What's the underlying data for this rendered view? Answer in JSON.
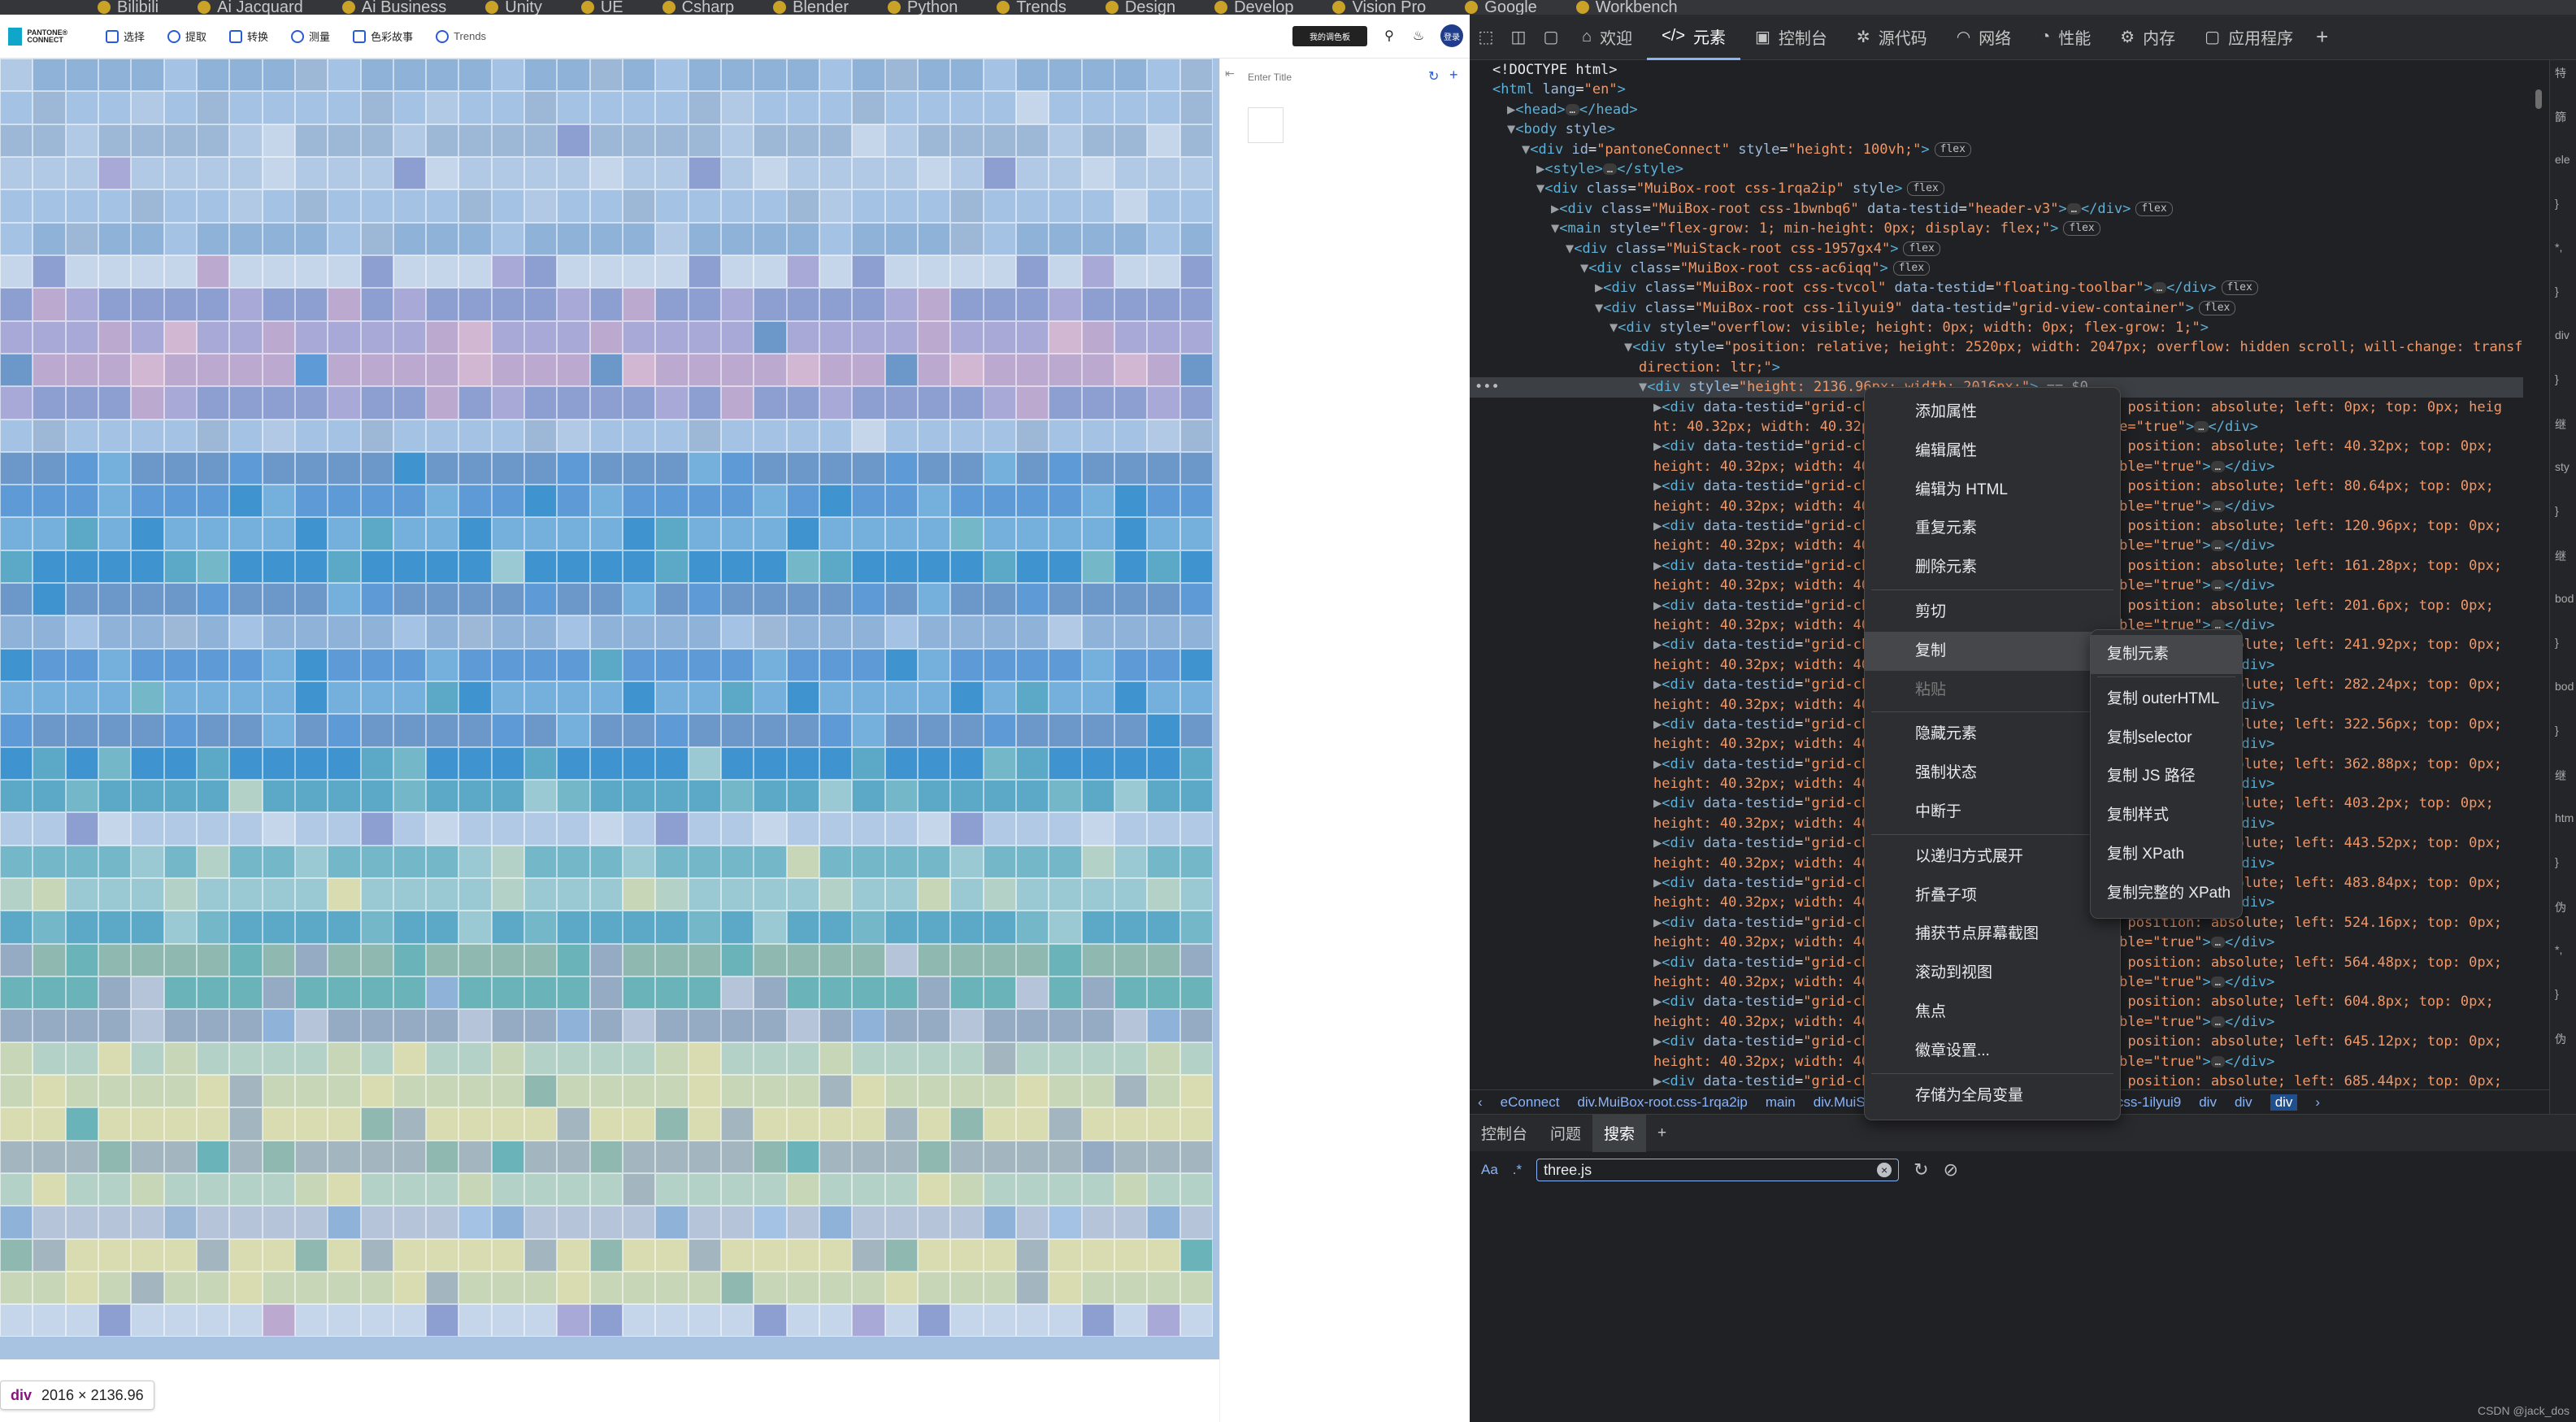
{
  "bookmarks": [
    "Bilibili",
    "Ai Jacquard",
    "Ai Business",
    "Unity",
    "UE",
    "Csharp",
    "Blender",
    "Python",
    "Trends",
    "Design",
    "Develop",
    "Vision Pro",
    "Google",
    "Workbench"
  ],
  "app": {
    "logo_text": "PANTONE® CONNECT",
    "nav": [
      {
        "label": "选择",
        "icon": "select-icon"
      },
      {
        "label": "提取",
        "icon": "extract-icon"
      },
      {
        "label": "转换",
        "icon": "convert-icon"
      },
      {
        "label": "测量",
        "icon": "measure-icon"
      },
      {
        "label": "色彩故事",
        "icon": "color-story-icon"
      },
      {
        "label": "Trends",
        "icon": "trends-icon"
      }
    ],
    "workspace_button": "我的调色板",
    "avatar": "登录",
    "side_title_placeholder": "Enter Title",
    "size_tooltip": {
      "tag": "div",
      "size": "2016 × 2136.96"
    },
    "grid": {
      "chip_size": 40.32,
      "cols": 37,
      "rows": 39,
      "palette": [
        "#8fb2d8",
        "#a3c2e4",
        "#9db7d6",
        "#b2c9e6",
        "#c5d6ea",
        "#8c9fd0",
        "#a8a9d6",
        "#bca9cf",
        "#d2b7d3",
        "#6b98c9",
        "#5e9bd6",
        "#75b0dd",
        "#3f94cf",
        "#5ca8c7",
        "#73b7c9",
        "#9ac9d3",
        "#b4d1c7",
        "#c7d6b6",
        "#d8dcb0",
        "#a3b5be",
        "#8eb8b0",
        "#6ab3b9",
        "#95aac3",
        "#b5c4d8"
      ]
    }
  },
  "devtools": {
    "tabs": [
      {
        "label": "欢迎",
        "icon": "home-icon"
      },
      {
        "label": "元素",
        "icon": "code-icon",
        "active": true
      },
      {
        "label": "控制台",
        "icon": "console-icon"
      },
      {
        "label": "源代码",
        "icon": "bug-icon"
      },
      {
        "label": "网络",
        "icon": "wifi-icon"
      },
      {
        "label": "性能",
        "icon": "gauge-icon"
      },
      {
        "label": "内存",
        "icon": "gear-icon"
      },
      {
        "label": "应用程序",
        "icon": "app-icon"
      }
    ],
    "tree_rows": [
      {
        "indent": 0,
        "html": "<span class='p'>&lt;!DOCTYPE html&gt;</span>"
      },
      {
        "indent": 0,
        "html": "<span class='t'>&lt;html</span> <span class='a'>lang</span>=<span class='v'>\"en\"</span><span class='t'>&gt;</span>"
      },
      {
        "indent": 1,
        "html": "<span class='g'>▶</span><span class='t'>&lt;head&gt;</span><span class='ell'>…</span><span class='t'>&lt;/head&gt;</span>"
      },
      {
        "indent": 1,
        "html": "<span class='g'>▼</span><span class='t'>&lt;body</span> <span class='a'>style</span><span class='t'>&gt;</span>"
      },
      {
        "indent": 2,
        "html": "<span class='g'>▼</span><span class='t'>&lt;div</span> <span class='a'>id</span>=<span class='v'>\"pantoneConnect\"</span> <span class='a'>style</span>=<span class='v'>\"height: 100vh;\"</span><span class='t'>&gt;</span><span class='flex-badge'>flex</span>"
      },
      {
        "indent": 3,
        "html": "<span class='g'>▶</span><span class='t'>&lt;style&gt;</span><span class='ell'>…</span><span class='t'>&lt;/style&gt;</span>"
      },
      {
        "indent": 3,
        "html": "<span class='g'>▼</span><span class='t'>&lt;div</span> <span class='a'>class</span>=<span class='v'>\"MuiBox-root css-1rqa2ip\"</span> <span class='a'>style</span><span class='t'>&gt;</span><span class='flex-badge'>flex</span>"
      },
      {
        "indent": 4,
        "html": "<span class='g'>▶</span><span class='t'>&lt;div</span> <span class='a'>class</span>=<span class='v'>\"MuiBox-root css-1bwnbq6\"</span> <span class='a'>data-testid</span>=<span class='v'>\"header-v3\"</span><span class='t'>&gt;</span><span class='ell'>…</span><span class='t'>&lt;/div&gt;</span><span class='flex-badge'>flex</span>"
      },
      {
        "indent": 4,
        "html": "<span class='g'>▼</span><span class='t'>&lt;main</span> <span class='a'>style</span>=<span class='v'>\"flex-grow: 1; min-height: 0px; display: flex;\"</span><span class='t'>&gt;</span><span class='flex-badge'>flex</span>"
      },
      {
        "indent": 5,
        "html": "<span class='g'>▼</span><span class='t'>&lt;div</span> <span class='a'>class</span>=<span class='v'>\"MuiStack-root css-1957gx4\"</span><span class='t'>&gt;</span><span class='flex-badge'>flex</span>"
      },
      {
        "indent": 6,
        "html": "<span class='g'>▼</span><span class='t'>&lt;div</span> <span class='a'>class</span>=<span class='v'>\"MuiBox-root css-ac6iqq\"</span><span class='t'>&gt;</span><span class='flex-badge'>flex</span>"
      },
      {
        "indent": 7,
        "html": "<span class='g'>▶</span><span class='t'>&lt;div</span> <span class='a'>class</span>=<span class='v'>\"MuiBox-root css-tvcol\"</span> <span class='a'>data-testid</span>=<span class='v'>\"floating-toolbar\"</span><span class='t'>&gt;</span><span class='ell'>…</span><span class='t'>&lt;/div&gt;</span><span class='flex-badge'>flex</span>"
      },
      {
        "indent": 7,
        "html": "<span class='g'>▼</span><span class='t'>&lt;div</span> <span class='a'>class</span>=<span class='v'>\"MuiBox-root css-1ilyui9\"</span> <span class='a'>data-testid</span>=<span class='v'>\"grid-view-container\"</span><span class='t'>&gt;</span><span class='flex-badge'>flex</span>"
      },
      {
        "indent": 8,
        "html": "<span class='g'>▼</span><span class='t'>&lt;div</span> <span class='a'>style</span>=<span class='v'>\"overflow: visible; height: 0px; width: 0px; flex-grow: 1;\"</span><span class='t'>&gt;</span>"
      },
      {
        "indent": 9,
        "html": "<span class='g'>▼</span><span class='t'>&lt;div</span> <span class='a'>style</span>=<span class='v'>\"position: relative; height: 2520px; width: 2047px; overflow: hidden scroll; will-change: transform;</span>"
      },
      {
        "indent": 10,
        "html": "<span class='v'>direction: ltr;\"</span><span class='t'>&gt;</span>"
      },
      {
        "indent": 10,
        "sel": true,
        "html": "<span class='g'>▼</span><span class='t'>&lt;div</span> <span class='a'>style</span>=<span class='v'>\"height: 2136.96px; width: 2016px;\"</span><span class='t'>&gt;</span> <span class='g'>== $0</span>"
      },
      {
        "indent": 11,
        "html": "<span class='g'>▶</span><span class='t'>&lt;div</span> <span class='a'>data-testid</span>=<span class='v'>\"grid-chip-</span>                   <span class='v'>pointer; position: absolute; left: 0px; top: 0px; heig</span>"
      },
      {
        "indent": 11,
        "html": "<span class='v'>ht: 40.32px; width: 40.32px;</span>                       <span class='v'>agable=\"true\"</span><span class='t'>&gt;</span><span class='ell'>…</span><span class='t'>&lt;/div&gt;</span>"
      },
      {
        "indent": 11,
        "html": "<span class='g'>▶</span><span class='t'>&lt;div</span> <span class='a'>data-testid</span>=<span class='v'>\"grid-chip-</span>                   <span class='v'>pointer; position: absolute; left: 40.32px; top: 0px;</span>"
      },
      {
        "indent": 11,
        "html": "<span class='v'>height: 40.32px; width: 40.3</span>                       <span class='v'>raggable=\"true\"</span><span class='t'>&gt;</span><span class='ell'>…</span><span class='t'>&lt;/div&gt;</span>"
      },
      {
        "indent": 11,
        "html": "<span class='g'>▶</span><span class='t'>&lt;div</span> <span class='a'>data-testid</span>=<span class='v'>\"grid-chip-</span>                   <span class='v'>pointer; position: absolute; left: 80.64px; top: 0px;</span>"
      },
      {
        "indent": 11,
        "html": "<span class='v'>height: 40.32px; width: 40.3</span>                       <span class='v'>raggable=\"true\"</span><span class='t'>&gt;</span><span class='ell'>…</span><span class='t'>&lt;/div&gt;</span>"
      },
      {
        "indent": 11,
        "html": "<span class='g'>▶</span><span class='t'>&lt;div</span> <span class='a'>data-testid</span>=<span class='v'>\"grid-chip-</span>                   <span class='v'>pointer; position: absolute; left: 120.96px; top: 0px;</span>"
      },
      {
        "indent": 11,
        "html": "<span class='v'>height: 40.32px; width: 40.3</span>                       <span class='v'>raggable=\"true\"</span><span class='t'>&gt;</span><span class='ell'>…</span><span class='t'>&lt;/div&gt;</span>"
      },
      {
        "indent": 11,
        "html": "<span class='g'>▶</span><span class='t'>&lt;div</span> <span class='a'>data-testid</span>=<span class='v'>\"grid-chip-</span>                   <span class='v'>pointer; position: absolute; left: 161.28px; top: 0px;</span>"
      },
      {
        "indent": 11,
        "html": "<span class='v'>height: 40.32px; width: 40.3</span>                       <span class='v'>raggable=\"true\"</span><span class='t'>&gt;</span><span class='ell'>…</span><span class='t'>&lt;/div&gt;</span>"
      },
      {
        "indent": 11,
        "html": "<span class='g'>▶</span><span class='t'>&lt;div</span> <span class='a'>data-testid</span>=<span class='v'>\"grid-chip-</span>                   <span class='v'>pointer; position: absolute; left: 201.6px; top: 0px;</span>"
      },
      {
        "indent": 11,
        "html": "<span class='v'>height: 40.32px; width: 40.3</span>                       <span class='v'>raggable=\"true\"</span><span class='t'>&gt;</span><span class='ell'>…</span><span class='t'>&lt;/div&gt;</span>"
      },
      {
        "indent": 11,
        "html": "<span class='g'>▶</span><span class='t'>&lt;div</span> <span class='a'>data-testid</span>=<span class='v'>\"grid-chip-</span>                   <span class='v'>pointer; position: absolute; left: 241.92px; top: 0px;</span>"
      },
      {
        "indent": 11,
        "html": "<span class='v'>height: 40.32px; width: 40.3</span>                       <span class='v'>raggable=\"true\"</span><span class='t'>&gt;</span><span class='ell'>…</span><span class='t'>&lt;/div&gt;</span>"
      },
      {
        "indent": 11,
        "html": "<span class='g'>▶</span><span class='t'>&lt;div</span> <span class='a'>data-testid</span>=<span class='v'>\"grid-chip-</span>                   <span class='v'>pointer; position: absolute; left: 282.24px; top: 0px;</span>"
      },
      {
        "indent": 11,
        "html": "<span class='v'>height: 40.32px; width: 40.3</span>                       <span class='v'>raggable=\"true\"</span><span class='t'>&gt;</span><span class='ell'>…</span><span class='t'>&lt;/div&gt;</span>"
      },
      {
        "indent": 11,
        "html": "<span class='g'>▶</span><span class='t'>&lt;div</span> <span class='a'>data-testid</span>=<span class='v'>\"grid-chip-</span>                   <span class='v'>pointer; position: absolute; left: 322.56px; top: 0px;</span>"
      },
      {
        "indent": 11,
        "html": "<span class='v'>height: 40.32px; width: 40.3</span>                       <span class='v'>raggable=\"true\"</span><span class='t'>&gt;</span><span class='ell'>…</span><span class='t'>&lt;/div&gt;</span>"
      },
      {
        "indent": 11,
        "html": "<span class='g'>▶</span><span class='t'>&lt;div</span> <span class='a'>data-testid</span>=<span class='v'>\"grid-chip-</span>                   <span class='v'>pointer; position: absolute; left: 362.88px; top: 0px;</span>"
      },
      {
        "indent": 11,
        "html": "<span class='v'>height: 40.32px; width: 40.3</span>                       <span class='v'>raggable=\"true\"</span><span class='t'>&gt;</span><span class='ell'>…</span><span class='t'>&lt;/div&gt;</span>"
      },
      {
        "indent": 11,
        "html": "<span class='g'>▶</span><span class='t'>&lt;div</span> <span class='a'>data-testid</span>=<span class='v'>\"grid-chip-</span>                   <span class='v'>pointer; position: absolute; left: 403.2px; top: 0px;</span>"
      },
      {
        "indent": 11,
        "html": "<span class='v'>height: 40.32px; width: 40.3</span>                       <span class='v'>raggable=\"true\"</span><span class='t'>&gt;</span><span class='ell'>…</span><span class='t'>&lt;/div&gt;</span>"
      },
      {
        "indent": 11,
        "html": "<span class='g'>▶</span><span class='t'>&lt;div</span> <span class='a'>data-testid</span>=<span class='v'>\"grid-chip-</span>                   <span class='v'>pointer; position: absolute; left: 443.52px; top: 0px;</span>"
      },
      {
        "indent": 11,
        "html": "<span class='v'>height: 40.32px; width: 40.3</span>                       <span class='v'>raggable=\"true\"</span><span class='t'>&gt;</span><span class='ell'>…</span><span class='t'>&lt;/div&gt;</span>"
      },
      {
        "indent": 11,
        "html": "<span class='g'>▶</span><span class='t'>&lt;div</span> <span class='a'>data-testid</span>=<span class='v'>\"grid-chip-</span>                   <span class='v'>pointer; position: absolute; left: 483.84px; top: 0px;</span>"
      },
      {
        "indent": 11,
        "html": "<span class='v'>height: 40.32px; width: 40.3</span>                       <span class='v'>raggable=\"true\"</span><span class='t'>&gt;</span><span class='ell'>…</span><span class='t'>&lt;/div&gt;</span>"
      },
      {
        "indent": 11,
        "html": "<span class='g'>▶</span><span class='t'>&lt;div</span> <span class='a'>data-testid</span>=<span class='v'>\"grid-chip-</span>                   <span class='v'>pointer; position: absolute; left: 524.16px; top: 0px;</span>"
      },
      {
        "indent": 11,
        "html": "<span class='v'>height: 40.32px; width: 40.3</span>                       <span class='v'>raggable=\"true\"</span><span class='t'>&gt;</span><span class='ell'>…</span><span class='t'>&lt;/div&gt;</span>"
      },
      {
        "indent": 11,
        "html": "<span class='g'>▶</span><span class='t'>&lt;div</span> <span class='a'>data-testid</span>=<span class='v'>\"grid-chip-</span>                   <span class='v'>pointer; position: absolute; left: 564.48px; top: 0px;</span>"
      },
      {
        "indent": 11,
        "html": "<span class='v'>height: 40.32px; width: 40.3</span>                       <span class='v'>raggable=\"true\"</span><span class='t'>&gt;</span><span class='ell'>…</span><span class='t'>&lt;/div&gt;</span>"
      },
      {
        "indent": 11,
        "html": "<span class='g'>▶</span><span class='t'>&lt;div</span> <span class='a'>data-testid</span>=<span class='v'>\"grid-chip-</span>                   <span class='v'>pointer; position: absolute; left: 604.8px; top: 0px;</span>"
      },
      {
        "indent": 11,
        "html": "<span class='v'>height: 40.32px; width: 40.3</span>                       <span class='v'>raggable=\"true\"</span><span class='t'>&gt;</span><span class='ell'>…</span><span class='t'>&lt;/div&gt;</span>"
      },
      {
        "indent": 11,
        "html": "<span class='g'>▶</span><span class='t'>&lt;div</span> <span class='a'>data-testid</span>=<span class='v'>\"grid-chip-</span>                   <span class='v'>pointer; position: absolute; left: 645.12px; top: 0px;</span>"
      },
      {
        "indent": 11,
        "html": "<span class='v'>height: 40.32px; width: 40.3</span>                       <span class='v'>raggable=\"true\"</span><span class='t'>&gt;</span><span class='ell'>…</span><span class='t'>&lt;/div&gt;</span>"
      },
      {
        "indent": 11,
        "html": "<span class='g'>▶</span><span class='t'>&lt;div</span> <span class='a'>data-testid</span>=<span class='v'>\"grid-chip-</span>                   <span class='v'>pointer; position: absolute; left: 685.44px; top: 0px;</span>"
      }
    ],
    "breadcrumbs": [
      "‹",
      "eConnect",
      "div.MuiBox-root.css-1rqa2ip",
      "main",
      "div.MuiSt",
      "ox-root.css-ac6iqq",
      "div.MuiBox-root.css-1ilyui9",
      "div",
      "div",
      "div",
      "›"
    ],
    "drawer_tabs": [
      "控制台",
      "问题",
      "搜索"
    ],
    "drawer_active": "搜索",
    "search": {
      "case_label": "Aa",
      "regex_label": ".*",
      "value": "three.js"
    },
    "watermark": "CSDN @jack_dos"
  },
  "context_menu": {
    "items": [
      {
        "label": "添加属性"
      },
      {
        "label": "编辑属性"
      },
      {
        "label": "编辑为 HTML"
      },
      {
        "label": "重复元素"
      },
      {
        "label": "删除元素"
      },
      {
        "sep": true
      },
      {
        "label": "剪切"
      },
      {
        "label": "复制",
        "sub": true,
        "hl": true
      },
      {
        "label": "粘贴",
        "dis": true
      },
      {
        "sep": true
      },
      {
        "label": "隐藏元素"
      },
      {
        "label": "强制状态",
        "sub": true
      },
      {
        "label": "中断于",
        "sub": true
      },
      {
        "sep": true
      },
      {
        "label": "以递归方式展开"
      },
      {
        "label": "折叠子项"
      },
      {
        "label": "捕获节点屏幕截图"
      },
      {
        "label": "滚动到视图"
      },
      {
        "label": "焦点"
      },
      {
        "label": "徽章设置..."
      },
      {
        "sep": true
      },
      {
        "label": "存储为全局变量"
      }
    ],
    "submenu": [
      {
        "label": "复制元素",
        "hl": true
      },
      {
        "sep": true
      },
      {
        "label": "复制 outerHTML"
      },
      {
        "label": "复制selector"
      },
      {
        "label": "复制 JS 路径"
      },
      {
        "label": "复制样式"
      },
      {
        "label": "复制 XPath"
      },
      {
        "label": "复制完整的 XPath"
      }
    ]
  }
}
